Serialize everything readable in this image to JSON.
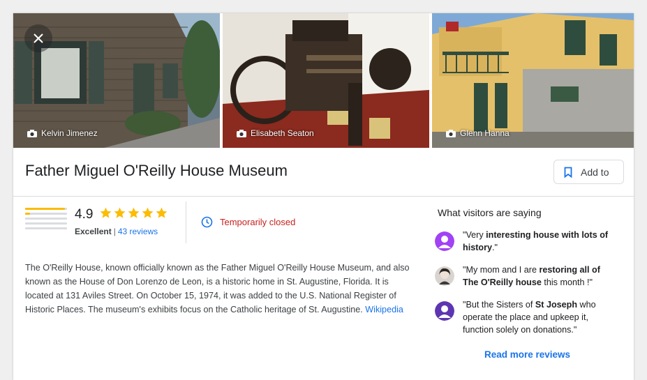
{
  "photos": [
    {
      "credit": "Kelvin Jimenez"
    },
    {
      "credit": "Elisabeth Seaton"
    },
    {
      "credit": "Glenn Hanna"
    }
  ],
  "place": {
    "title": "Father Miguel O'Reilly House Museum",
    "add_button_label": "Add to"
  },
  "rating": {
    "score": "4.9",
    "stars": 5,
    "label": "Excellent",
    "separator": "|",
    "reviews_link": "43 reviews",
    "distribution": [
      0.95,
      0.12,
      0.0,
      0.0,
      0.0
    ]
  },
  "status": {
    "text": "Temporarily closed",
    "color": "#c5221f"
  },
  "description": {
    "text": "The O'Reilly House, known officially known as the Father Miguel O'Reilly House Museum, and also known as the House of Don Lorenzo de Leon, is a historic home in St. Augustine, Florida. It is located at 131 Aviles Street. On October 15, 1974, it was added to the U.S. National Register of Historic Places. The museum's exhibits focus on the Catholic heritage of St. Augustine.",
    "link": "Wikipedia"
  },
  "visitors": {
    "title": "What visitors are saying",
    "reviews": [
      {
        "parts": [
          "\"Very ",
          "interesting house with lots of history",
          ".\""
        ]
      },
      {
        "parts": [
          "\"My mom and I are ",
          "restoring all of The O'Reilly house",
          " this month !\""
        ]
      },
      {
        "parts": [
          "\"But the Sisters of ",
          "St Joseph",
          " who operate the place and upkeep it, function solely on donations.\""
        ]
      }
    ],
    "read_more": "Read more reviews"
  },
  "colors": {
    "accent": "#1a73e8",
    "star": "#fbbc04",
    "closed": "#c5221f"
  },
  "icons": [
    "close-icon",
    "camera-icon",
    "bookmark-icon",
    "star-icon",
    "clock-icon",
    "avatar-icon"
  ]
}
